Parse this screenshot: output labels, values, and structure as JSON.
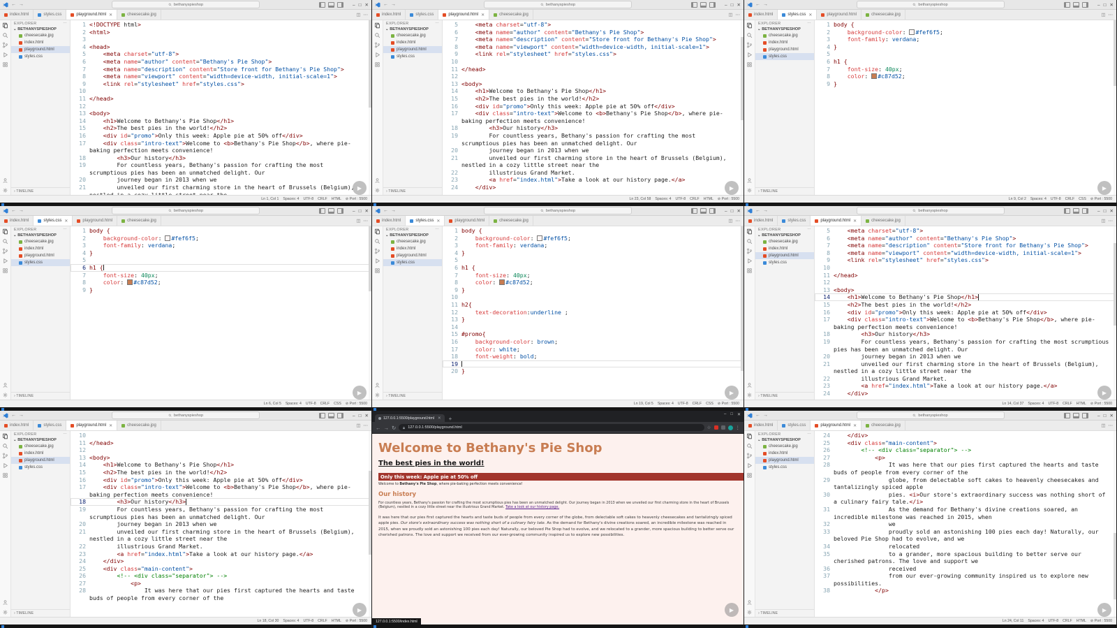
{
  "workspace": {
    "window_title": "bethanyspieshop",
    "explorer_label": "EXPLORER",
    "folder": "BETHANYSPIESHOP",
    "timeline_label": "TIMELINE",
    "files": [
      {
        "name": "cheesecake.jpg",
        "type": "img"
      },
      {
        "name": "index.html",
        "type": "html"
      },
      {
        "name": "playground.html",
        "type": "html"
      },
      {
        "name": "styles.css",
        "type": "css"
      }
    ],
    "tabs": [
      {
        "label": "index.html",
        "type": "html"
      },
      {
        "label": "styles.css",
        "type": "css"
      },
      {
        "label": "playground.html",
        "type": "html"
      },
      {
        "label": "cheesecake.jpg",
        "type": "img"
      }
    ]
  },
  "statusbar": {
    "spaces": "Spaces: 4",
    "encoding": "UTF-8",
    "eol": "CRLF",
    "port": "⊘ Port : 5500"
  },
  "file_colors": {
    "html": "#e44d26",
    "css": "#3b8ad8",
    "img": "#7cb342"
  },
  "html_lines": [
    "<!DOCTYPE html>",
    "<html>",
    "",
    "<head>",
    "    <meta charset=\"utf-8\">",
    "    <meta name=\"author\" content=\"Bethany's Pie Shop\">",
    "    <meta name=\"description\" content=\"Store front for Bethany's Pie Shop\">",
    "    <meta name=\"viewport\" content=\"width=device-width, initial-scale=1\">",
    "    <link rel=\"stylesheet\" href=\"styles.css\">",
    "",
    "</head>",
    "",
    "<body>",
    "    <h1>Welcome to Bethany's Pie Shop</h1>",
    "    <h2>The best pies in the world!</h2>",
    "    <div id=\"promo\">Only this week: Apple pie at 50% off</div>",
    "    <div class=\"intro-text\">Welcome to <b>Bethany's Pie Shop</b>, where pie-baking perfection meets convenience!",
    "        <h3>Our history</h3>",
    "        For countless years, Bethany's passion for crafting the most scrumptious pies has been an unmatched delight. Our",
    "        journey began in 2013 when we",
    "        unveiled our first charming store in the heart of Brussels (Belgium), nestled in a cozy little street near the",
    "        illustrious Grand Market.",
    "        <a href=\"index.html\">Take a look at our history page.</a>",
    "    </div>",
    "    <div class=\"main-content\">",
    "        <!-- <div class=\"separator\"> -->",
    "            <p>",
    "                It was here that our pies first captured the hearts and taste buds of people from every corner of the",
    "                globe, from delectable soft cakes to heavenly cheesecakes and tantalizingly spiced apple",
    "                pies. <i>Our store's extraordinary success was nothing short of a culinary fairy tale.</i>",
    "                As the demand for Bethany's divine creations soared, an incredible milestone was reached in 2015, when",
    "                we",
    "                proudly sold an astonishing 100 pies each day! Naturally, our beloved Pie Shop had to evolve, and we",
    "                relocated",
    "                to a grander, more spacious building to better serve our cherished patrons. The love and support we",
    "                received",
    "                from our ever-growing community inspired us to explore new possibilities.",
    "            </p>"
  ],
  "css_lines": [
    "body {",
    "    background-color: #fef6f5;",
    "    font-family: verdana;",
    "}",
    "",
    "h1 {",
    "    font-size: 40px;",
    "    color: #c87d52;",
    "}",
    "",
    "h2{",
    "    text-decoration:underline ;",
    "}",
    "",
    "#promo{",
    "    background-color: brown;",
    "    color: white;",
    "    font-weight: bold;",
    "",
    "}"
  ],
  "panels": [
    {
      "kind": "vscode",
      "lang": "html",
      "start": 1,
      "end": 21,
      "tab": "playground.html",
      "status_ln": "Ln 1, Col 1",
      "mode": "HTML",
      "active_line": 0,
      "cursor": false
    },
    {
      "kind": "vscode",
      "lang": "html",
      "start": 5,
      "end": 24,
      "tab": "playground.html",
      "status_ln": "Ln 23, Col 58",
      "mode": "HTML",
      "active_line": 0,
      "cursor": false
    },
    {
      "kind": "vscode",
      "lang": "css",
      "start": 1,
      "end": 9,
      "tab": "styles.css",
      "status_ln": "Ln 9, Col 2",
      "mode": "CSS",
      "active_line": 0,
      "cursor": false
    },
    {
      "kind": "vscode",
      "lang": "css",
      "start": 1,
      "end": 9,
      "tab": "styles.css",
      "status_ln": "Ln 6, Col 5",
      "mode": "CSS",
      "active_line": 6,
      "cursor": true
    },
    {
      "kind": "vscode",
      "lang": "css",
      "start": 1,
      "end": 20,
      "tab": "styles.css",
      "status_ln": "Ln 19, Col 5",
      "mode": "CSS",
      "active_line": 19,
      "cursor": true
    },
    {
      "kind": "vscode",
      "lang": "html",
      "start": 5,
      "end": 24,
      "tab": "playground.html",
      "status_ln": "Ln 14, Col 37",
      "mode": "HTML",
      "active_line": 14,
      "cursor": true
    },
    {
      "kind": "vscode",
      "lang": "html",
      "start": 10,
      "end": 28,
      "tab": "playground.html",
      "status_ln": "Ln 18, Col 30",
      "mode": "HTML",
      "active_line": 18,
      "cursor": true
    },
    {
      "kind": "browser"
    },
    {
      "kind": "vscode",
      "lang": "html",
      "start": 24,
      "end": 38,
      "tab": "playground.html",
      "status_ln": "Ln 24, Col 11",
      "mode": "HTML",
      "active_line": 0,
      "cursor": false
    }
  ],
  "browser": {
    "tab_title": "127.0.0.1:5500/playground.html",
    "url": "127.0.0.1:5500/playground.html",
    "status_link": "127.0.0.1:5500/index.html",
    "page": {
      "h1": "Welcome to Bethany's Pie Shop",
      "h2": "The best pies in the world!",
      "promo": "Only this week: Apple pie at 50% off",
      "intro_pre": "Welcome to ",
      "intro_bold": "Bethany's Pie Shop",
      "intro_post": ", where pie-baking perfection meets convenience!",
      "h3": "Our history",
      "p1": "For countless years, Bethany's passion for crafting the most scrumptious pies has been an unmatched delight. Our journey began in 2013 when we unveiled our first charming store in the heart of Brussels (Belgium), nestled in a cozy little street near the illustrious Grand Market. ",
      "p1_link": "Take a look at our history page.",
      "p2_a": "It was here that our pies first captured the hearts and taste buds of people from every corner of the globe, from delectable soft cakes to heavenly cheesecakes and tantalizingly spiced apple pies. ",
      "p2_i": "Our store's extraordinary success was nothing short of a culinary fairy tale.",
      "p2_b": " As the demand for Bethany's divine creations soared, an incredible milestone was reached in 2015, when we proudly sold an astonishing 100 pies each day! Naturally, our beloved Pie Shop had to evolve, and we relocated to a grander, more spacious building to better serve our cherished patrons. The love and support we received from our ever-growing community inspired us to explore new possibilities."
    },
    "colors": {
      "accent": "#c87d52",
      "page_bg": "#fdf1ee",
      "promo_bg": "#a2352c"
    }
  }
}
